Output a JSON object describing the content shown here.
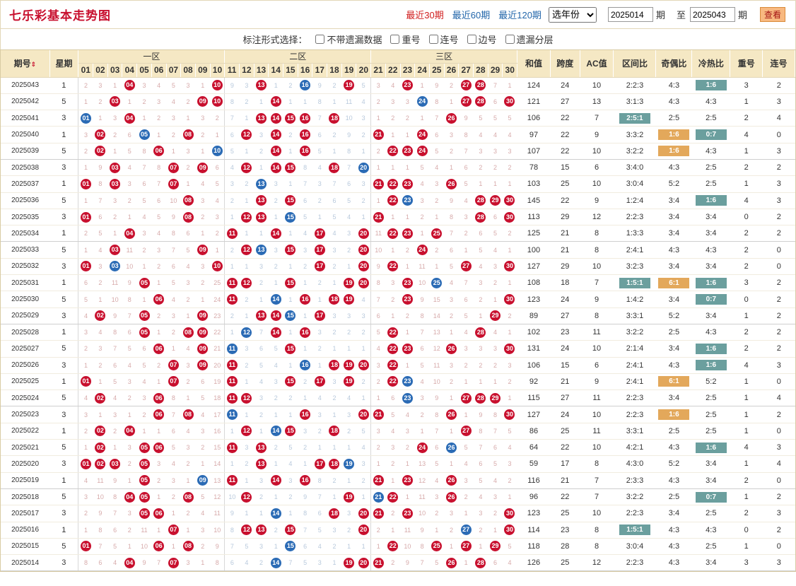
{
  "header": {
    "title": "七乐彩基本走势图",
    "periods": [
      "最近30期",
      "最近60期",
      "最近120期"
    ],
    "year_select": "选年份",
    "from_label": "期",
    "to_prefix": "至",
    "to_label": "期",
    "from_value": "2025014",
    "to_value": "2025043",
    "view_btn": "查看"
  },
  "options": {
    "label": "标注形式选择：",
    "items": [
      "不带遗漏数据",
      "重号",
      "连号",
      "边号",
      "遗漏分层"
    ]
  },
  "table": {
    "headers": {
      "qi": "期号",
      "xq": "星期",
      "zones": [
        "一区",
        "二区",
        "三区"
      ],
      "extras": [
        "和值",
        "跨度",
        "AC值",
        "区间比",
        "奇偶比",
        "冷热比",
        "重号",
        "连号"
      ]
    },
    "rows": [
      {
        "qi": "2025043",
        "xq": "1",
        "h": "124",
        "k": "24",
        "ac": "10",
        "q": "2:2:3",
        "jo": "4:3",
        "lr": "1:6",
        "lrh": "g",
        "ch": "3",
        "lh": "2",
        "b": [
          4,
          10,
          13,
          19,
          23,
          27,
          28
        ],
        "s": [
          16
        ]
      },
      {
        "qi": "2025042",
        "xq": "5",
        "h": "121",
        "k": "27",
        "ac": "13",
        "q": "3:1:3",
        "jo": "4:3",
        "lr": "4:3",
        "ch": "1",
        "lh": "3",
        "b": [
          3,
          9,
          10,
          14,
          27,
          28,
          30
        ],
        "s": [
          24
        ]
      },
      {
        "qi": "2025041",
        "xq": "3",
        "h": "106",
        "k": "22",
        "ac": "7",
        "q": "2:5:1",
        "qh": "g",
        "jo": "2:5",
        "lr": "2:5",
        "ch": "2",
        "lh": "4",
        "lhc": "blue",
        "b": [
          4,
          13,
          14,
          15,
          16,
          18,
          26
        ],
        "s": [
          1
        ]
      },
      {
        "qi": "2025040",
        "xq": "1",
        "h": "97",
        "k": "22",
        "ac": "9",
        "q": "3:3:2",
        "jo": "1:6",
        "joh": "y",
        "lr": "0:7",
        "lrh": "g",
        "ch": "4",
        "chc": "red",
        "lh": "0",
        "b": [
          2,
          8,
          12,
          14,
          16,
          21,
          24
        ],
        "s": [
          5
        ]
      },
      {
        "qi": "2025039",
        "xq": "5",
        "h": "107",
        "k": "22",
        "ac": "10",
        "q": "3:2:2",
        "jo": "1:6",
        "joh": "y",
        "lr": "4:3",
        "ch": "1",
        "lh": "3",
        "b": [
          2,
          6,
          14,
          16,
          22,
          23,
          24
        ],
        "s": [
          10
        ]
      },
      {
        "qi": "2025038",
        "xq": "3",
        "h": "78",
        "k": "15",
        "ac": "6",
        "q": "3:4:0",
        "jo": "4:3",
        "lr": "2:5",
        "ch": "2",
        "lh": "2",
        "b": [
          3,
          7,
          9,
          12,
          14,
          15,
          18
        ],
        "s": [
          20
        ]
      },
      {
        "qi": "2025037",
        "xq": "1",
        "h": "103",
        "k": "25",
        "ac": "10",
        "q": "3:0:4",
        "jo": "5:2",
        "lr": "2:5",
        "ch": "1",
        "lh": "3",
        "b": [
          1,
          3,
          7,
          21,
          22,
          23,
          26
        ],
        "s": [
          13
        ]
      },
      {
        "qi": "2025036",
        "xq": "5",
        "h": "145",
        "k": "22",
        "ac": "9",
        "q": "1:2:4",
        "jo": "3:4",
        "lr": "1:6",
        "lrh": "g",
        "ch": "4",
        "chc": "red",
        "lh": "3",
        "b": [
          8,
          13,
          15,
          22,
          28,
          29,
          30
        ],
        "s": [
          23
        ]
      },
      {
        "qi": "2025035",
        "xq": "3",
        "h": "113",
        "k": "29",
        "ac": "12",
        "q": "2:2:3",
        "jo": "3:4",
        "lr": "3:4",
        "ch": "0",
        "lh": "2",
        "b": [
          1,
          8,
          12,
          13,
          21,
          28,
          30
        ],
        "s": [
          15
        ]
      },
      {
        "qi": "2025034",
        "xq": "1",
        "h": "125",
        "k": "21",
        "ac": "8",
        "q": "1:3:3",
        "jo": "3:4",
        "lr": "3:4",
        "ch": "2",
        "lh": "2",
        "b": [
          4,
          11,
          14,
          17,
          20,
          22,
          23,
          25
        ],
        "s": []
      },
      {
        "qi": "2025033",
        "xq": "5",
        "h": "100",
        "k": "21",
        "ac": "8",
        "q": "2:4:1",
        "jo": "4:3",
        "lr": "4:3",
        "ch": "2",
        "lh": "0",
        "b": [
          3,
          9,
          12,
          15,
          17,
          20,
          24
        ],
        "s": [
          13
        ]
      },
      {
        "qi": "2025032",
        "xq": "3",
        "h": "127",
        "k": "29",
        "ac": "10",
        "q": "3:2:3",
        "jo": "3:4",
        "lr": "3:4",
        "ch": "2",
        "lh": "0",
        "b": [
          1,
          10,
          17,
          20,
          22,
          27,
          30
        ],
        "s": [
          3
        ]
      },
      {
        "qi": "2025031",
        "xq": "1",
        "h": "108",
        "k": "18",
        "ac": "7",
        "q": "1:5:1",
        "qh": "g",
        "jo": "6:1",
        "joh": "y",
        "lr": "1:6",
        "lrh": "g",
        "ch": "3",
        "lh": "2",
        "b": [
          5,
          11,
          12,
          15,
          19,
          20,
          23
        ],
        "s": [
          25
        ]
      },
      {
        "qi": "2025030",
        "xq": "5",
        "h": "123",
        "k": "24",
        "ac": "9",
        "q": "1:4:2",
        "jo": "3:4",
        "lr": "0:7",
        "lrh": "g",
        "ch": "0",
        "lh": "2",
        "b": [
          6,
          11,
          16,
          18,
          19,
          23,
          30
        ],
        "s": [
          14
        ]
      },
      {
        "qi": "2025029",
        "xq": "3",
        "h": "89",
        "k": "27",
        "ac": "8",
        "q": "3:3:1",
        "jo": "5:2",
        "lr": "3:4",
        "ch": "1",
        "lh": "2",
        "b": [
          2,
          5,
          9,
          13,
          14,
          17,
          29
        ],
        "s": [
          15
        ]
      },
      {
        "qi": "2025028",
        "xq": "1",
        "h": "102",
        "k": "23",
        "ac": "11",
        "q": "3:2:2",
        "jo": "2:5",
        "lr": "4:3",
        "ch": "2",
        "lh": "2",
        "b": [
          5,
          8,
          9,
          14,
          16,
          22,
          28
        ],
        "s": [
          12
        ]
      },
      {
        "qi": "2025027",
        "xq": "5",
        "h": "131",
        "k": "24",
        "ac": "10",
        "q": "2:1:4",
        "jo": "3:4",
        "lr": "1:6",
        "lrh": "g",
        "ch": "2",
        "lh": "2",
        "b": [
          6,
          9,
          15,
          22,
          23,
          26,
          30
        ],
        "s": [
          11
        ]
      },
      {
        "qi": "2025026",
        "xq": "3",
        "h": "106",
        "k": "15",
        "ac": "6",
        "q": "2:4:1",
        "jo": "4:3",
        "lr": "1:6",
        "lrh": "g",
        "ch": "4",
        "chc": "red",
        "lh": "3",
        "b": [
          7,
          9,
          11,
          18,
          19,
          20,
          22
        ],
        "s": [
          16
        ]
      },
      {
        "qi": "2025025",
        "xq": "1",
        "h": "92",
        "k": "21",
        "ac": "9",
        "q": "2:4:1",
        "jo": "6:1",
        "joh": "y",
        "lr": "5:2",
        "ch": "1",
        "lh": "0",
        "b": [
          1,
          7,
          11,
          15,
          17,
          19,
          22
        ],
        "s": [
          23
        ]
      },
      {
        "qi": "2025024",
        "xq": "5",
        "h": "115",
        "k": "27",
        "ac": "11",
        "q": "2:2:3",
        "jo": "3:4",
        "lr": "2:5",
        "ch": "1",
        "lh": "4",
        "lhc": "blue",
        "b": [
          2,
          6,
          11,
          12,
          27,
          28,
          29
        ],
        "s": [
          23
        ]
      },
      {
        "qi": "2025023",
        "xq": "3",
        "h": "127",
        "k": "24",
        "ac": "10",
        "q": "2:2:3",
        "jo": "1:6",
        "joh": "y",
        "lr": "2:5",
        "ch": "1",
        "lh": "2",
        "b": [
          6,
          8,
          16,
          20,
          21,
          26,
          30
        ],
        "s": [
          11
        ]
      },
      {
        "qi": "2025022",
        "xq": "1",
        "h": "86",
        "k": "25",
        "ac": "11",
        "q": "3:3:1",
        "jo": "2:5",
        "lr": "2:5",
        "ch": "1",
        "lh": "0",
        "b": [
          2,
          4,
          12,
          15,
          18,
          27
        ],
        "s": [
          14
        ]
      },
      {
        "qi": "2025021",
        "xq": "5",
        "h": "64",
        "k": "22",
        "ac": "10",
        "q": "4:2:1",
        "jo": "4:3",
        "lr": "1:6",
        "lrh": "g",
        "ch": "4",
        "chc": "red",
        "lh": "3",
        "b": [
          2,
          5,
          6,
          11,
          13,
          24
        ],
        "s": [
          26
        ]
      },
      {
        "qi": "2025020",
        "xq": "3",
        "h": "59",
        "k": "17",
        "ac": "8",
        "q": "4:3:0",
        "jo": "5:2",
        "lr": "3:4",
        "ch": "1",
        "lh": "4",
        "lhc": "blue",
        "b": [
          1,
          2,
          3,
          5,
          13,
          17,
          18
        ],
        "s": [
          19
        ]
      },
      {
        "qi": "2025019",
        "xq": "1",
        "h": "116",
        "k": "21",
        "ac": "7",
        "q": "2:3:3",
        "jo": "4:3",
        "lr": "3:4",
        "ch": "2",
        "lh": "0",
        "b": [
          5,
          11,
          14,
          16,
          21,
          23,
          26
        ],
        "s": [
          9
        ]
      },
      {
        "qi": "2025018",
        "xq": "5",
        "h": "96",
        "k": "22",
        "ac": "7",
        "q": "3:2:2",
        "jo": "2:5",
        "lr": "0:7",
        "lrh": "g",
        "ch": "1",
        "lh": "2",
        "b": [
          4,
          5,
          8,
          12,
          19,
          22,
          26
        ],
        "s": [
          21
        ]
      },
      {
        "qi": "2025017",
        "xq": "3",
        "h": "123",
        "k": "25",
        "ac": "10",
        "q": "2:2:3",
        "jo": "3:4",
        "lr": "2:5",
        "ch": "2",
        "lh": "3",
        "b": [
          5,
          6,
          18,
          20,
          21,
          23,
          30
        ],
        "s": [
          14
        ]
      },
      {
        "qi": "2025016",
        "xq": "1",
        "h": "114",
        "k": "23",
        "ac": "8",
        "q": "1:5:1",
        "qh": "g",
        "jo": "4:3",
        "lr": "4:3",
        "ch": "0",
        "lh": "2",
        "b": [
          7,
          12,
          13,
          15,
          20,
          30
        ],
        "s": [
          27
        ]
      },
      {
        "qi": "2025015",
        "xq": "5",
        "h": "118",
        "k": "28",
        "ac": "8",
        "q": "3:0:4",
        "jo": "4:3",
        "lr": "2:5",
        "ch": "1",
        "lh": "0",
        "b": [
          1,
          6,
          8,
          22,
          25,
          27,
          29
        ],
        "s": [
          15
        ]
      },
      {
        "qi": "2025014",
        "xq": "3",
        "h": "126",
        "k": "25",
        "ac": "12",
        "q": "2:2:3",
        "jo": "4:3",
        "lr": "3:4",
        "ch": "3",
        "lh": "3",
        "b": [
          4,
          7,
          19,
          20,
          21,
          26,
          28
        ],
        "s": [
          14
        ]
      }
    ]
  }
}
